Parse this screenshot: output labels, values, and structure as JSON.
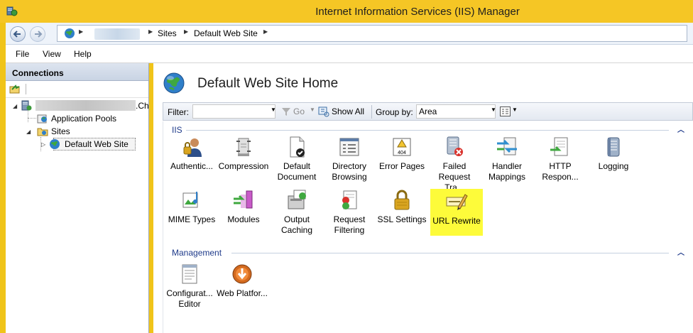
{
  "window": {
    "title": "Internet Information Services (IIS) Manager"
  },
  "address": {
    "crumbs": [
      "Sites",
      "Default Web Site"
    ]
  },
  "menu": {
    "items": [
      "File",
      "View",
      "Help"
    ]
  },
  "connections": {
    "header": "Connections",
    "server_suffix": ".Ch",
    "app_pools": "Application Pools",
    "sites": "Sites",
    "default_site": "Default Web Site"
  },
  "main": {
    "title": "Default Web Site Home",
    "filter": {
      "label": "Filter:",
      "value": "",
      "go": "Go",
      "show_all": "Show All",
      "group_by_label": "Group by:",
      "group_by_value": "Area"
    },
    "groups": [
      {
        "name": "IIS",
        "features": [
          {
            "label": "Authentic...",
            "icon": "authentication-icon"
          },
          {
            "label": "Compression",
            "icon": "compression-icon"
          },
          {
            "label": "Default Document",
            "icon": "default-document-icon"
          },
          {
            "label": "Directory Browsing",
            "icon": "directory-browsing-icon"
          },
          {
            "label": "Error Pages",
            "icon": "error-pages-icon"
          },
          {
            "label": "Failed Request Tra...",
            "icon": "failed-request-tracing-icon"
          },
          {
            "label": "Handler Mappings",
            "icon": "handler-mappings-icon"
          },
          {
            "label": "HTTP Respon...",
            "icon": "http-response-headers-icon"
          },
          {
            "label": "Logging",
            "icon": "logging-icon"
          },
          {
            "label": "MIME Types",
            "icon": "mime-types-icon"
          },
          {
            "label": "Modules",
            "icon": "modules-icon"
          },
          {
            "label": "Output Caching",
            "icon": "output-caching-icon"
          },
          {
            "label": "Request Filtering",
            "icon": "request-filtering-icon"
          },
          {
            "label": "SSL Settings",
            "icon": "ssl-settings-icon"
          },
          {
            "label": "URL Rewrite",
            "icon": "url-rewrite-icon",
            "highlighted": true
          }
        ]
      },
      {
        "name": "Management",
        "features": [
          {
            "label": "Configurat... Editor",
            "icon": "configuration-editor-icon"
          },
          {
            "label": "Web Platfor...",
            "icon": "web-platform-installer-icon"
          }
        ]
      }
    ]
  },
  "colors": {
    "titlebar": "#f5c625",
    "highlight": "#fdfb3a",
    "group_text": "#1e3a8a"
  }
}
